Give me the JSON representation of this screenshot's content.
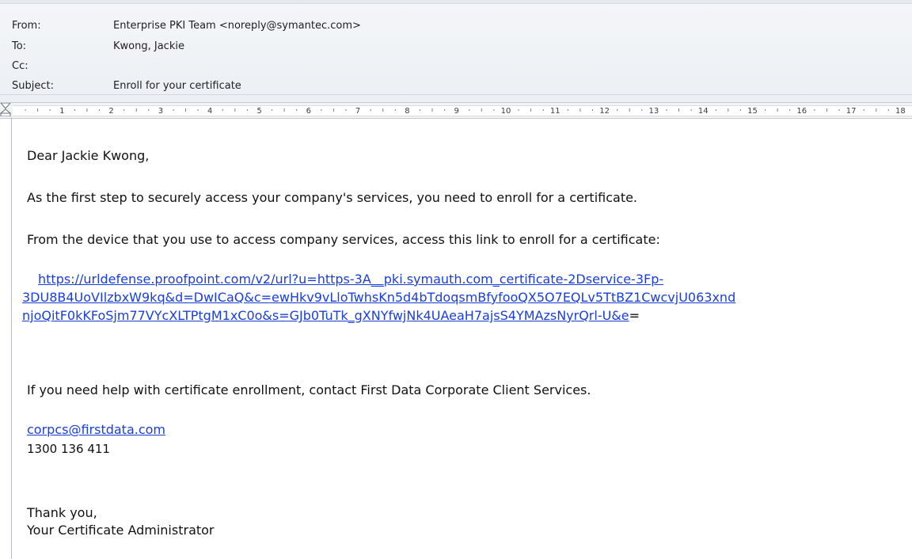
{
  "header": {
    "from_label": "From:",
    "from_value": "Enterprise PKI Team <noreply@symantec.com>",
    "to_label": "To:",
    "to_value": "Kwong, Jackie",
    "cc_label": "Cc:",
    "cc_value": "",
    "subject_label": "Subject:",
    "subject_value": "Enroll for your certificate"
  },
  "ruler": {
    "numbers": [
      "1",
      "2",
      "3",
      "4",
      "5",
      "6",
      "7",
      "8",
      "9",
      "10",
      "11",
      "12",
      "13",
      "14",
      "15",
      "16",
      "17",
      "18"
    ]
  },
  "body": {
    "greeting": "Dear Jackie Kwong,",
    "para1": "As the first step to securely access your company's services, you need to enroll for a certificate.",
    "para2": "From the device that you use to access company services, access this link to enroll for a certificate:",
    "link_line1": "https://urldefense.proofpoint.com/v2/url?u=https-3A__pki.symauth.com_certificate-2Dservice-3Fp-",
    "link_line2": "3DU8B4UoVIlzbxW9kq&d=DwICaQ&c=ewHkv9vLloTwhsKn5d4bTdoqsmBfyfooQX5O7EQLv5TtBZ1CwcvjU063xnd",
    "link_line3": "njoQitF0kKFoSjm77VYcXLTPtgM1xC0o&s=GJb0TuTk_gXNYfwjNk4UAeaH7ajsS4YMAzsNyrQrl-U&e",
    "link_tail": "=",
    "help_text": "If you need help with certificate enrollment, contact First Data Corporate Client Services.",
    "contact_email": "corpcs@firstdata.com",
    "contact_phone": "1300 136 411",
    "thanks": "Thank you,",
    "signature": "Your Certificate Administrator"
  },
  "colors": {
    "link": "#1a3fd6",
    "header_bg": "#eceff3",
    "text": "#111111"
  }
}
